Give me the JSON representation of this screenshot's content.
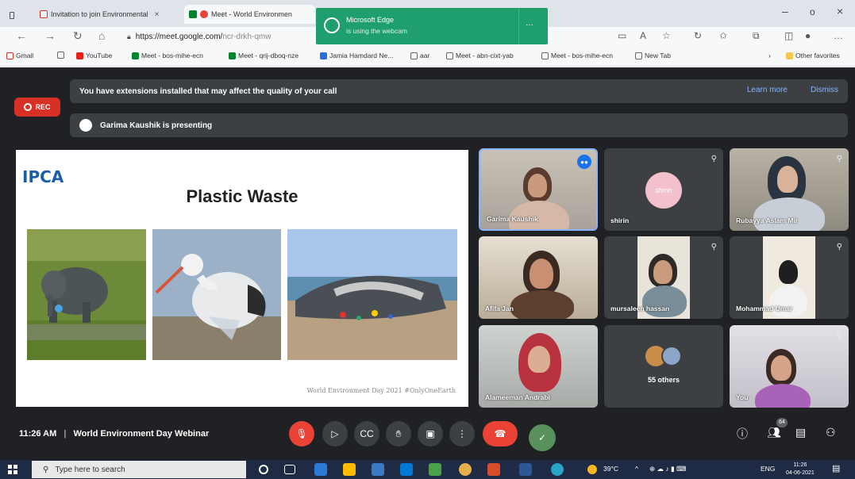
{
  "browser": {
    "tabs": [
      {
        "label": "Invitation to join Environmental",
        "icon": "gmail-icon",
        "active": false
      },
      {
        "label": "Meet - World Environmen",
        "icon": "meet-icon",
        "active": true,
        "recording": true
      }
    ],
    "window_controls": {
      "minimize": "–",
      "maximize": "o",
      "close": "×"
    },
    "url_host": "https://meet.google.com/",
    "url_path": "ncr-drkh-qmw",
    "bookmarks": [
      {
        "label": "Gmail",
        "icon": "gmail-icon"
      },
      {
        "label": "",
        "icon": "page-icon"
      },
      {
        "label": "YouTube",
        "icon": "youtube-icon"
      },
      {
        "label": "Meet - bos-mihe-ecn",
        "icon": "meet-icon"
      },
      {
        "label": "Meet - qrij-dboq-nze",
        "icon": "meet-icon"
      },
      {
        "label": "Jamia Hamdard Ne...",
        "icon": "jamia-icon"
      },
      {
        "label": "aar",
        "icon": "page-icon"
      },
      {
        "label": "Meet - abn-cixt-yab",
        "icon": "page-icon"
      },
      {
        "label": "Meet - bos-mihe-ecn",
        "icon": "page-icon"
      },
      {
        "label": "New Tab",
        "icon": "page-icon"
      }
    ],
    "other_favorites": "Other favorites",
    "toast": {
      "title": "Microsoft Edge",
      "subtitle": "is using the webcam"
    }
  },
  "meet": {
    "rec_label": "REC",
    "extension_banner": "You have extensions installed that may affect the quality of your call",
    "learn_more": "Learn more",
    "dismiss": "Dismiss",
    "presenting_banner": "Garima Kaushik is presenting",
    "slide": {
      "logo": "IPCA",
      "title": "Plastic Waste",
      "footer": "World Environment Day 2021 #OnlyOneEarth"
    },
    "participants": [
      {
        "name": "Garima Kaushik"
      },
      {
        "name": "shirin",
        "avatar_text": "shirin"
      },
      {
        "name": "Rubayya Aslam Mir"
      },
      {
        "name": "Afifa Jan"
      },
      {
        "name": "mursaleen hassan"
      },
      {
        "name": "Mohammad Umar"
      },
      {
        "name": "Alameeman Andrabi"
      },
      {
        "name": "55 others"
      },
      {
        "name": "You"
      }
    ],
    "meeting_time": "11:26 AM",
    "meeting_separator": "|",
    "meeting_title": "World Environment Day Webinar",
    "participant_count_badge": "64"
  },
  "taskbar": {
    "search_placeholder": "Type here to search",
    "weather": "39°C",
    "language": "ENG",
    "time": "11:26",
    "date": "04-06-2021"
  }
}
